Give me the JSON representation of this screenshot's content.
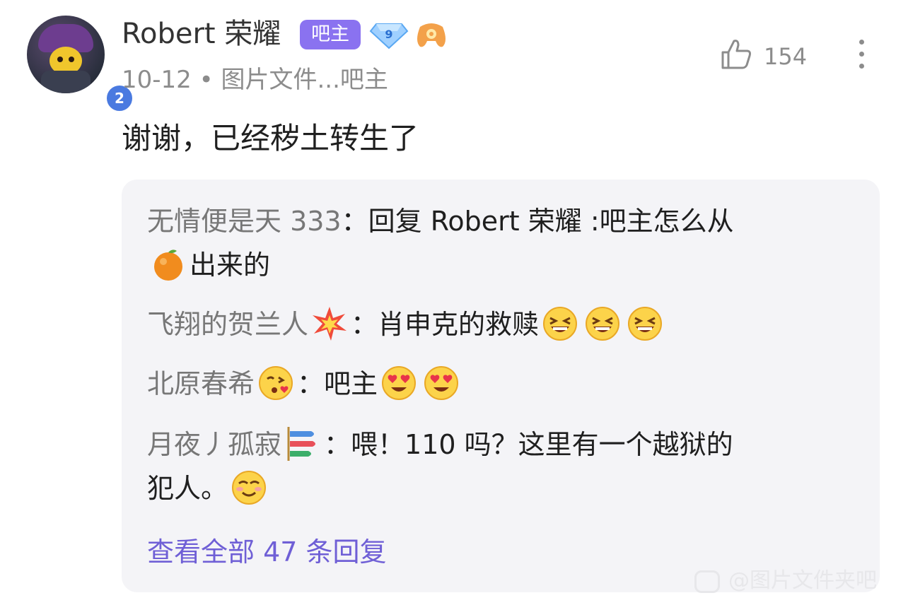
{
  "comment": {
    "username": "Robert 荣耀",
    "owner_tag": "吧主",
    "level_badge": "2",
    "diamond_level": "9",
    "meta": "10-12 • 图片文件...吧主",
    "like_count": "154",
    "text": "谢谢，已经秽土转生了"
  },
  "replies": [
    {
      "name": "无情便是天 333",
      "sep": "：",
      "text_a": "回复  Robert 荣耀 :吧主怎么从",
      "text_b": "出来的",
      "emoji": [
        "tangerine-emoji"
      ]
    },
    {
      "name": "飞翔的贺兰人",
      "sep": "：",
      "text": "肖申克的救赎",
      "emoji": [
        "collision-emoji",
        "grinning-squint-emoji",
        "grinning-squint-emoji",
        "grinning-squint-emoji"
      ]
    },
    {
      "name": "北原春希",
      "sep": "：",
      "text": "吧主",
      "emoji": [
        "kissing-heart-emoji",
        "heart-eyes-emoji",
        "heart-eyes-emoji"
      ]
    },
    {
      "name": "月夜丿孤寂",
      "sep": "：",
      "text_a": "喂！110 吗？这里有一个越狱的",
      "text_b": "犯人。",
      "emoji": [
        "carp-streamer-emoji",
        "smiling-blush-emoji"
      ]
    }
  ],
  "view_all": "查看全部 47 条回复",
  "watermark": "@图片文件夹吧"
}
